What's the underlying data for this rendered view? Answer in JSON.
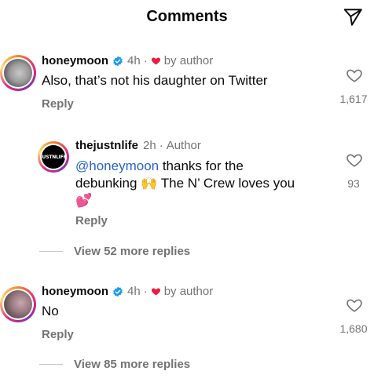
{
  "header": {
    "title": "Comments"
  },
  "icons": {
    "send": "send-icon",
    "like": "heart-outline-icon",
    "author_like": "heart-filled-icon",
    "verified": "verified-badge-icon"
  },
  "colors": {
    "accent": "#2563c9",
    "verified": "#1d9bf0",
    "heart": "#ed1c40",
    "muted": "#737373"
  },
  "comments": [
    {
      "username": "honeymoon",
      "time": "4h",
      "separator": "·",
      "author_tag": "by author",
      "text": "Also, that’s not his daughter on Twitter",
      "reply_label": "Reply",
      "likes": "1,617"
    },
    {
      "username": "thejustnlife",
      "time": "2h",
      "separator": "·",
      "author_tag": "Author",
      "avatar_text": "JUSTNLIFE",
      "mention": "@honeymoon",
      "text_line1": " thanks for the",
      "text_line2": "debunking 🙌 The N’ Crew loves you",
      "text_line3": "💕",
      "reply_label": "Reply",
      "likes": "93"
    },
    {
      "username": "honeymoon",
      "time": "4h",
      "separator": "·",
      "author_tag": "by author",
      "text": "No",
      "reply_label": "Reply",
      "likes": "1,680"
    }
  ],
  "view_more": [
    {
      "label": "View 52 more replies"
    },
    {
      "label": "View 85 more replies"
    }
  ]
}
